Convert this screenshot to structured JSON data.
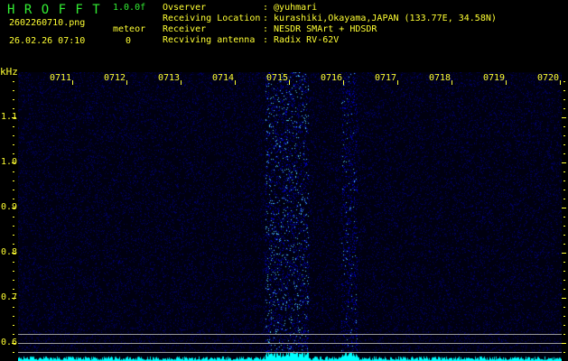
{
  "header": {
    "title": "H R O F F T",
    "version": "1.0.0f",
    "filename": "2602260710.png",
    "datetime": "26.02.26 07:10",
    "meteor_label": "meteor",
    "meteor_count": "0"
  },
  "info": [
    {
      "label": "Ovserver",
      "value": ": @yuhmari"
    },
    {
      "label": "Receiving Location",
      "value": ": kurashiki,Okayama,JAPAN (133.77E, 34.58N)"
    },
    {
      "label": "Receiver",
      "value": ": NESDR SMArt + HDSDR"
    },
    {
      "label": "Recviving antenna",
      "value": ": Radix RV-62V"
    }
  ],
  "axis": {
    "y_unit": "kHz",
    "y_ticks": [
      "1.1",
      "1.0",
      "0.9",
      "0.8",
      "0.7",
      "0.6"
    ],
    "x_ticks": [
      "0711",
      "0712",
      "0713",
      "0714",
      "0715",
      "0716",
      "0717",
      "0718",
      "0719",
      "0720"
    ]
  },
  "colors": {
    "text": "#ffff33",
    "title": "#33ee33",
    "signal": "#00ffff",
    "noise": "#1a1aff"
  }
}
